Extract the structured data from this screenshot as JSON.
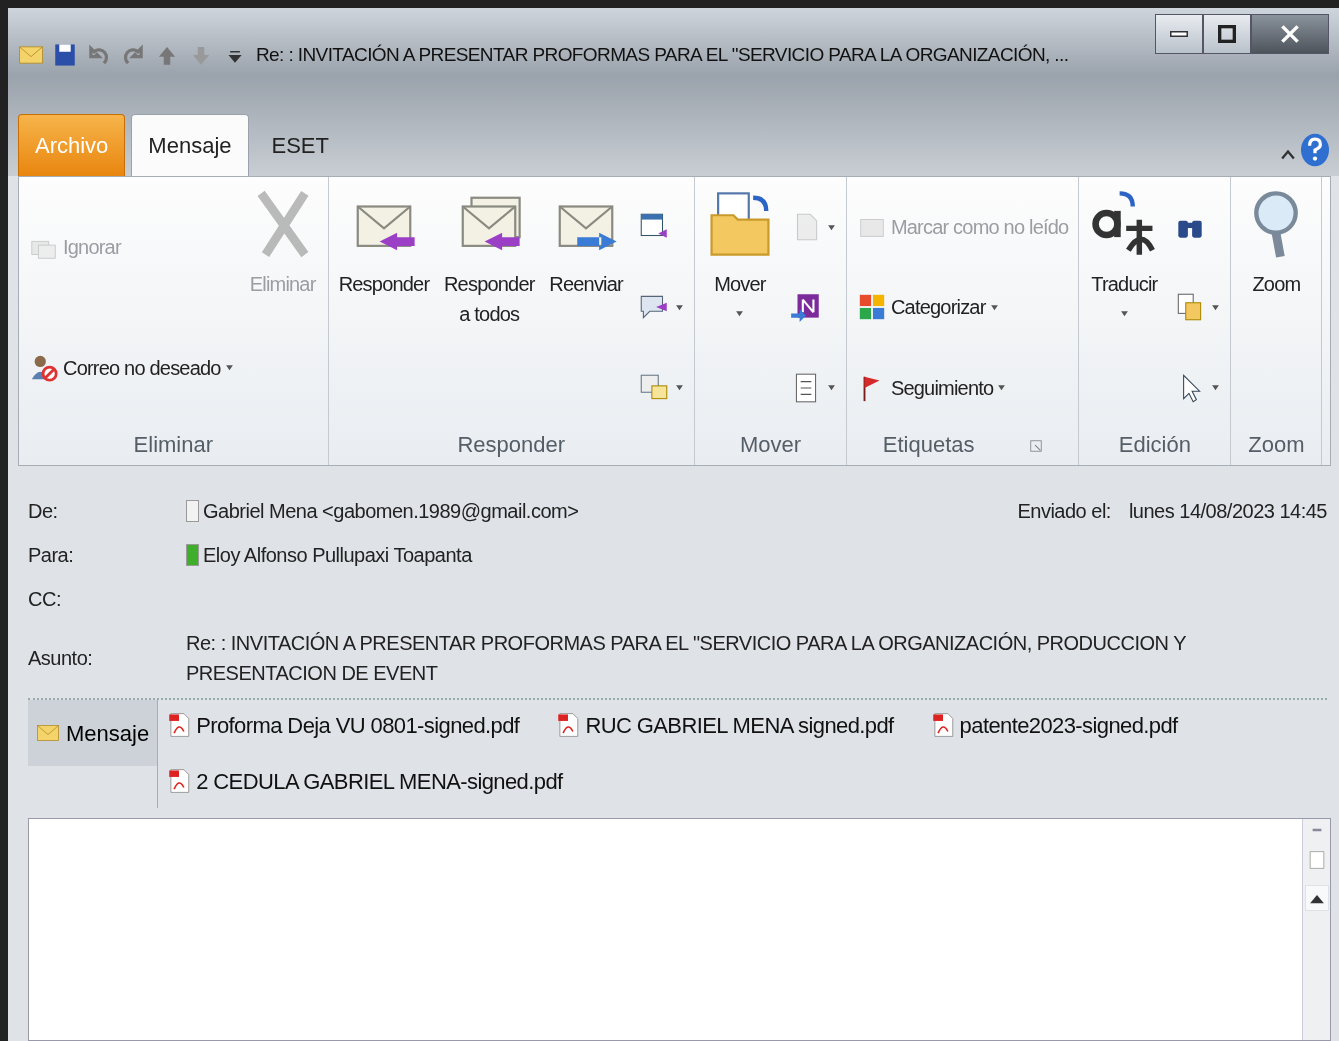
{
  "window": {
    "title": "Re: : INVITACIÓN A PRESENTAR PROFORMAS PARA EL \"SERVICIO PARA LA ORGANIZACIÓN, ..."
  },
  "tabs": [
    {
      "label": "Archivo",
      "kind": "file",
      "selected": false
    },
    {
      "label": "Mensaje",
      "kind": "tab",
      "selected": true
    },
    {
      "label": "ESET",
      "kind": "tab",
      "selected": false
    }
  ],
  "ribbon_groups": [
    {
      "label": "Eliminar",
      "launcher": false,
      "columns": [
        [
          {
            "kind": "small",
            "label": "Ignorar",
            "disabled": true,
            "dropdown": false
          },
          {
            "kind": "small",
            "label": "Correo no deseado",
            "disabled": false,
            "dropdown": true
          }
        ],
        [
          {
            "kind": "large",
            "label": "Eliminar",
            "disabled": true,
            "dropdown": false
          }
        ]
      ]
    },
    {
      "label": "Responder",
      "launcher": false,
      "columns": [
        [
          {
            "kind": "large",
            "label": "Responder",
            "disabled": false,
            "dropdown": false
          }
        ],
        [
          {
            "kind": "large",
            "label": "Responder a todos",
            "disabled": false,
            "dropdown": false
          }
        ],
        [
          {
            "kind": "large",
            "label": "Reenviar",
            "disabled": false,
            "dropdown": false
          }
        ],
        [
          {
            "kind": "icon",
            "disabled": false,
            "dropdown": false
          },
          {
            "kind": "icon",
            "disabled": false,
            "dropdown": true
          },
          {
            "kind": "icon",
            "disabled": false,
            "dropdown": true
          }
        ]
      ]
    },
    {
      "label": "Mover",
      "launcher": false,
      "columns": [
        [
          {
            "kind": "large",
            "label": "Mover",
            "disabled": false,
            "dropdown": true
          }
        ],
        [
          {
            "kind": "icon",
            "disabled": true,
            "dropdown": true
          },
          {
            "kind": "icon",
            "disabled": false,
            "dropdown": false
          },
          {
            "kind": "icon",
            "disabled": false,
            "dropdown": true
          }
        ]
      ]
    },
    {
      "label": "Etiquetas",
      "launcher": true,
      "columns": [
        [
          {
            "kind": "small",
            "label": "Marcar como no leído",
            "disabled": true,
            "dropdown": false
          },
          {
            "kind": "small",
            "label": "Categorizar",
            "disabled": false,
            "dropdown": true
          },
          {
            "kind": "small",
            "label": "Seguimiento",
            "disabled": false,
            "dropdown": true
          }
        ]
      ]
    },
    {
      "label": "Edición",
      "launcher": false,
      "columns": [
        [
          {
            "kind": "large",
            "label": "Traducir",
            "disabled": false,
            "dropdown": true
          }
        ],
        [
          {
            "kind": "icon",
            "disabled": false,
            "dropdown": false
          },
          {
            "kind": "icon",
            "disabled": false,
            "dropdown": true
          },
          {
            "kind": "icon",
            "disabled": false,
            "dropdown": true
          }
        ]
      ]
    },
    {
      "label": "Zoom",
      "launcher": false,
      "columns": [
        [
          {
            "kind": "large",
            "label": "Zoom",
            "disabled": false,
            "dropdown": false
          }
        ]
      ]
    }
  ],
  "header": {
    "fields": [
      {
        "label": "De:",
        "value": "Gabriel Mena <gabomen.1989@gmail.com>",
        "color": "#f2f2f2"
      },
      {
        "label": "Para:",
        "value": "Eloy Alfonso Pullupaxi Toapanta",
        "color": "#3fae2a"
      },
      {
        "label": "CC:"
      },
      {
        "label": "Asunto:",
        "value": "Re: : INVITACIÓN A PRESENTAR PROFORMAS PARA EL \"SERVICIO PARA LA ORGANIZACIÓN, PRODUCCION Y PRESENTACION DE EVENT"
      }
    ],
    "sent_label": "Enviado el:",
    "sent_value": "lunes 14/08/2023 14:45"
  },
  "attachments": {
    "message_tab": {
      "label": "Mensaje",
      "selected": true
    },
    "files": [
      "Proforma Deja VU 0801-signed.pdf",
      "RUC GABRIEL MENA signed.pdf",
      "patente2023-signed.pdf",
      "2 CEDULA GABRIEL MENA-signed.pdf"
    ]
  }
}
